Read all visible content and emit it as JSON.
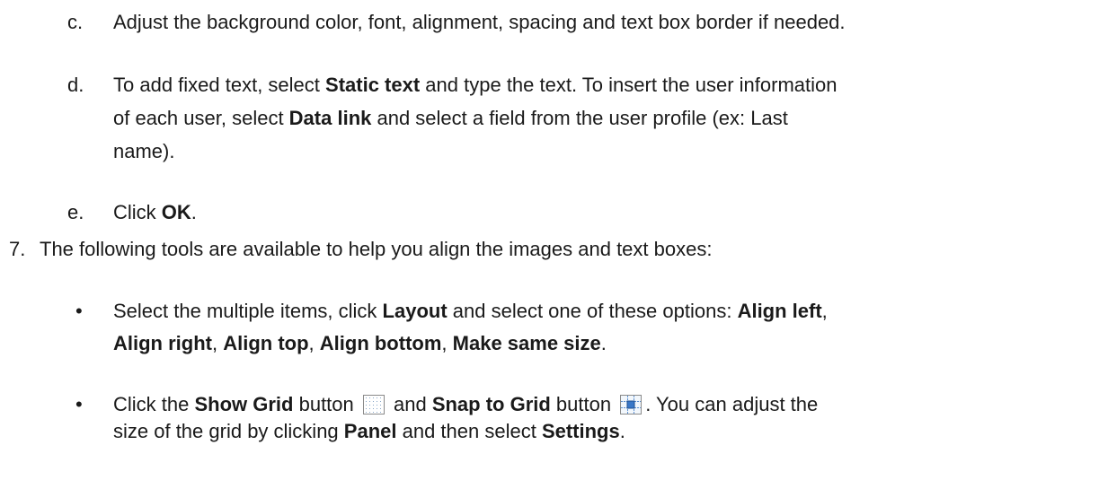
{
  "steps": {
    "c": {
      "marker": "c.",
      "text": "Adjust the background color, font, alignment, spacing and text box border if needed."
    },
    "d": {
      "marker": "d.",
      "t1": "To add fixed text, select ",
      "b1": "Static text",
      "t2": " and type the text. To insert the user information",
      "t3": "of each user, select ",
      "b2": "Data link",
      "t4": " and select a field from the user profile (ex: Last",
      "t5": "name)."
    },
    "e": {
      "marker": "e.",
      "t1": "Click ",
      "b1": "OK",
      "t2": "."
    },
    "seven": {
      "marker": "7.",
      "text": "The following tools are available to help you align the images and text boxes:"
    },
    "bullet1": {
      "t1": "Select the multiple items, click ",
      "b1": "Layout",
      "t2": " and select one of these options: ",
      "b2": "Align left",
      "t3": ",",
      "b3": "Align right",
      "t4": ", ",
      "b4": "Align top",
      "t5": ", ",
      "b5": "Align bottom",
      "t6": ", ",
      "b6": "Make same size",
      "t7": "."
    },
    "bullet2": {
      "t1": "Click the ",
      "b1": "Show Grid",
      "t2": " button ",
      "t3": " and ",
      "b2": "Snap to Grid",
      "t4": " button ",
      "t5": ". You can adjust the",
      "t6": "size of the grid by clicking ",
      "b3": "Panel",
      "t7": " and then select ",
      "b4": "Settings",
      "t8": "."
    },
    "bullet_symbol": "•",
    "icons": {
      "show_grid": "show-grid-icon",
      "snap_to_grid": "snap-to-grid-icon"
    }
  }
}
